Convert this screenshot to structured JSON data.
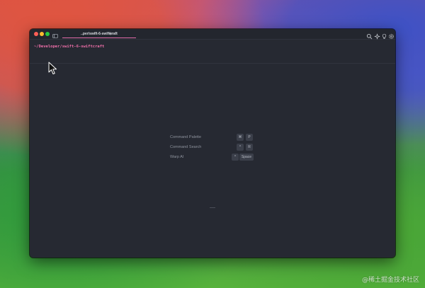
{
  "window": {
    "tab_title": "..per/swift-6-swiftcraft",
    "new_tab_label": "+",
    "accent_color": "#e06ba8",
    "background_color": "#262932"
  },
  "terminal": {
    "prompt_path": "~/Developer/swift-6-swiftcraft"
  },
  "toolbar_icons": [
    "search-icon",
    "sparkle-icon",
    "lightbulb-icon",
    "settings-icon"
  ],
  "shortcuts": [
    {
      "label": "Command Palette",
      "keys": [
        "⌘",
        "P"
      ]
    },
    {
      "label": "Command Search",
      "keys": [
        "^",
        "R"
      ]
    },
    {
      "label": "Warp AI",
      "keys": [
        "^",
        "Space"
      ]
    }
  ],
  "watermark": "@稀土掘金技术社区"
}
